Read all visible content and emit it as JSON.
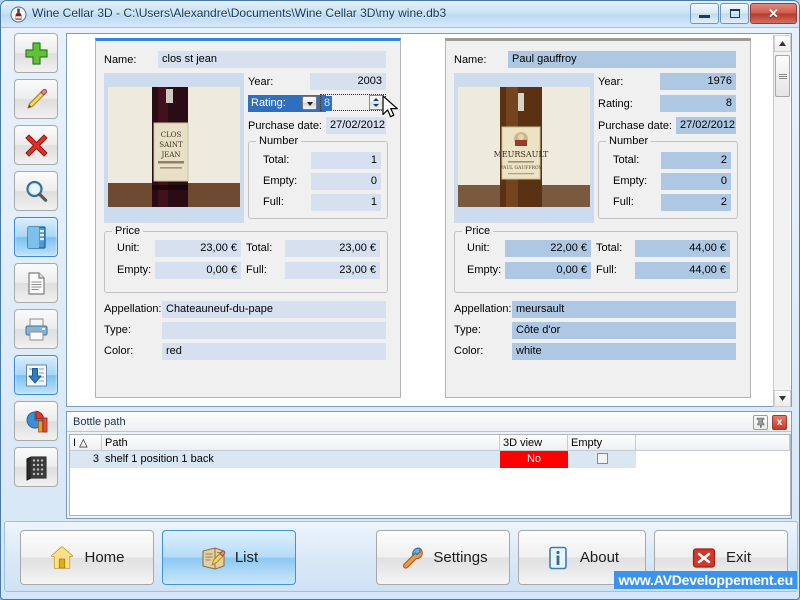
{
  "window": {
    "title": "Wine Cellar 3D - C:\\Users\\Alexandre\\Documents\\Wine Cellar 3D\\my wine.db3",
    "icon": "wine-bottle-icon",
    "minimize_label": "",
    "maximize_label": "",
    "close_label": "✕"
  },
  "sidebar": {
    "items": [
      {
        "name": "add",
        "icon": "plus-icon",
        "selected": false
      },
      {
        "name": "edit",
        "icon": "pencil-icon",
        "selected": false
      },
      {
        "name": "delete",
        "icon": "red-x-icon",
        "selected": false
      },
      {
        "name": "search",
        "icon": "magnifier-icon",
        "selected": false
      },
      {
        "name": "card-view",
        "icon": "card-view-icon",
        "selected": true
      },
      {
        "name": "report",
        "icon": "document-icon",
        "selected": false
      },
      {
        "name": "print",
        "icon": "printer-icon",
        "selected": false
      },
      {
        "name": "export",
        "icon": "export-download-icon",
        "selected": true
      },
      {
        "name": "statistics",
        "icon": "pie-chart-icon",
        "selected": false
      },
      {
        "name": "cellar-3d",
        "icon": "cellar-rack-icon",
        "selected": false
      }
    ]
  },
  "records": [
    {
      "id": "left",
      "selected": true,
      "labels": {
        "name": "Name:",
        "year": "Year:",
        "rating": "Rating:",
        "purchase_date": "Purchase date:",
        "number_group": "Number",
        "total": "Total:",
        "empty": "Empty:",
        "full": "Full:",
        "price_group": "Price",
        "unit": "Unit:",
        "price_total": "Total:",
        "price_empty": "Empty:",
        "price_full": "Full:",
        "appellation": "Appellation:",
        "type": "Type:",
        "color": "Color:"
      },
      "values": {
        "name": "clos st jean",
        "year": "2003",
        "rating": "8",
        "purchase_date": "27/02/2012",
        "total": "1",
        "empty": "0",
        "full": "1",
        "unit": "23,00 €",
        "price_total": "23,00 €",
        "price_empty": "0,00 €",
        "price_full": "23,00 €",
        "appellation": "Chateauneuf-du-pape",
        "type": "",
        "color": "red"
      },
      "photo": "wine-bottle-photo-clos-st-jean",
      "rating_editing": true
    },
    {
      "id": "right",
      "selected": false,
      "labels": {
        "name": "Name:",
        "year": "Year:",
        "rating": "Rating:",
        "purchase_date": "Purchase date:",
        "number_group": "Number",
        "total": "Total:",
        "empty": "Empty:",
        "full": "Full:",
        "price_group": "Price",
        "unit": "Unit:",
        "price_total": "Total:",
        "price_empty": "Empty:",
        "price_full": "Full:",
        "appellation": "Appellation:",
        "type": "Type:",
        "color": "Color:"
      },
      "values": {
        "name": "Paul gauffroy",
        "year": "1976",
        "rating": "8",
        "purchase_date": "27/02/2012",
        "total": "2",
        "empty": "0",
        "full": "2",
        "unit": "22,00 €",
        "price_total": "44,00 €",
        "price_empty": "0,00 €",
        "price_full": "44,00 €",
        "appellation": "meursault",
        "type": "Côte d'or",
        "color": "white"
      },
      "photo": "wine-bottle-photo-meursault",
      "rating_editing": false
    }
  ],
  "dock": {
    "title": "Bottle path",
    "pin_icon": "pin-icon",
    "close_icon": "close-icon",
    "close_label": "x",
    "columns": [
      "I △",
      "Path",
      "3D view",
      "Empty"
    ],
    "rows": [
      {
        "index": "3",
        "path": "shelf 1 position 1 back",
        "view3d": "No",
        "empty_checked": false
      }
    ]
  },
  "toolbar": {
    "buttons": [
      {
        "label": "Home",
        "icon": "home-icon",
        "selected": false
      },
      {
        "label": "List",
        "icon": "list-icon",
        "selected": true
      },
      {
        "label": "Settings",
        "icon": "wrench-icon",
        "selected": false
      },
      {
        "label": "About",
        "icon": "info-icon",
        "selected": false
      },
      {
        "label": "Exit",
        "icon": "exit-x-icon",
        "selected": false
      }
    ]
  },
  "watermark": {
    "text": "www.AVDeveloppement.eu"
  },
  "colors": {
    "accent": "#2f88e0",
    "field_unselected": "#d6e0ef",
    "field_selected": "#aec8e4",
    "no_badge": "#ff0000",
    "watermark_bg": "#3b93f0"
  }
}
